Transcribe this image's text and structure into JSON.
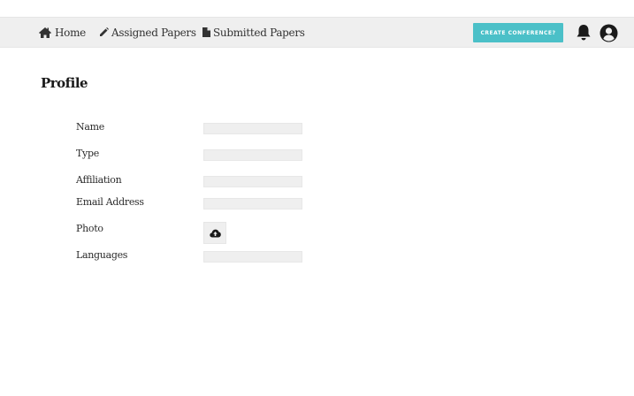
{
  "nav": {
    "home": {
      "label": "Home",
      "icon": "home-icon"
    },
    "assigned": {
      "label": "Assigned Papers",
      "icon": "pencil-icon"
    },
    "submitted": {
      "label": "Submitted Papers",
      "icon": "file-icon"
    },
    "create_label": "CREATE CONFERENCE?",
    "bell_icon": "bell-icon",
    "user_icon": "user-circle-icon"
  },
  "page": {
    "title": "Profile"
  },
  "form": {
    "name_label": "Name",
    "name_value": "",
    "type_label": "Type",
    "type_value": "",
    "affiliation_label": "Affiliation",
    "affiliation_value": "",
    "email_label": "Email Address",
    "email_value": "",
    "photo_label": "Photo",
    "photo_icon": "cloud-upload-icon",
    "languages_label": "Languages",
    "languages_value": ""
  },
  "colors": {
    "accent": "#4bc0c8",
    "navbar_bg": "#efefef",
    "input_bg": "#efefef"
  }
}
